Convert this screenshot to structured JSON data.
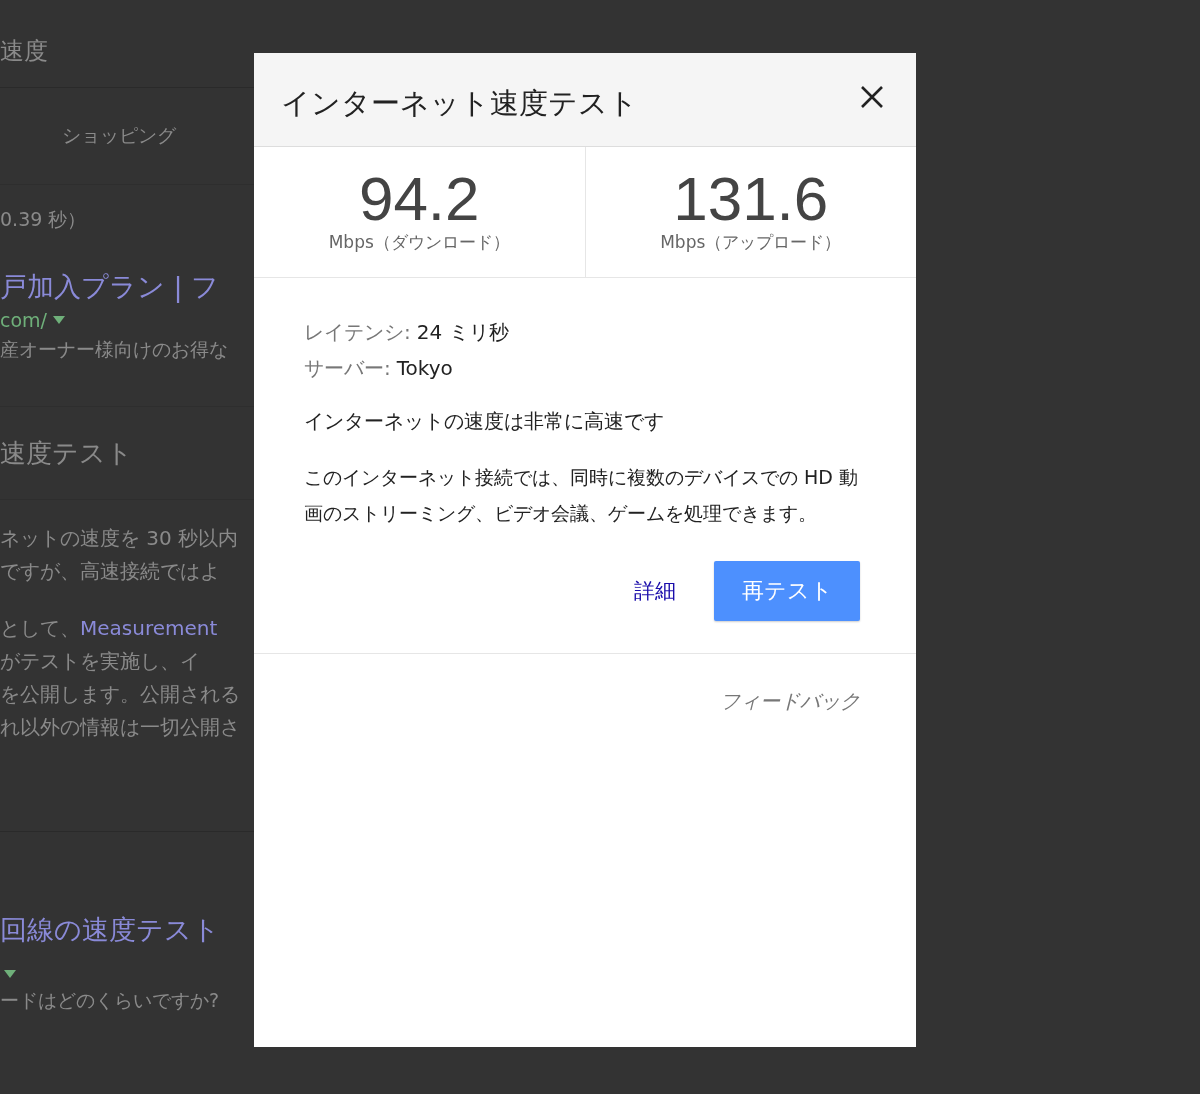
{
  "background": {
    "search_query": "速度",
    "tabs": [
      {
        "label": "ショッピング",
        "selected": false
      }
    ],
    "result_stats": "0.39 秒）",
    "result_1": {
      "title": "戸加入プラン | フ",
      "url": "com/",
      "snippet": "産オーナー様向けのお得な"
    },
    "card": {
      "heading": "速度テスト",
      "lines": [
        {
          "text": "ネットの速度を 30 秒以内"
        },
        {
          "text": "ですが、高速接続ではよ"
        },
        {
          "text": "として、",
          "link": "Measurement"
        },
        {
          "text": "がテストを実施し、イ"
        },
        {
          "text": "を公開します。公開される"
        },
        {
          "text": "れ以外の情報は一切公開さ"
        }
      ]
    },
    "result_2": {
      "title": "回線の速度テスト",
      "snippet": "ードはどのくらいですか?"
    }
  },
  "dialog": {
    "title": "インターネット速度テスト",
    "speeds": [
      {
        "value": "94.2",
        "unit": "Mbps（ダウンロード）"
      },
      {
        "value": "131.6",
        "unit": "Mbps（アップロード）"
      }
    ],
    "details": [
      {
        "label": "レイテンシ:",
        "value": "24 ミリ秒"
      },
      {
        "label": "サーバー:",
        "value": "Tokyo"
      }
    ],
    "summary": "インターネットの速度は非常に高速です",
    "description": "このインターネット接続では、同時に複数のデバイスでの HD 動画のストリーミング、ビデオ会議、ゲームを処理できます。",
    "buttons": [
      {
        "label": "詳細",
        "kind": "link"
      },
      {
        "label": "再テスト",
        "kind": "primary"
      }
    ],
    "feedback": "フィードバック"
  }
}
